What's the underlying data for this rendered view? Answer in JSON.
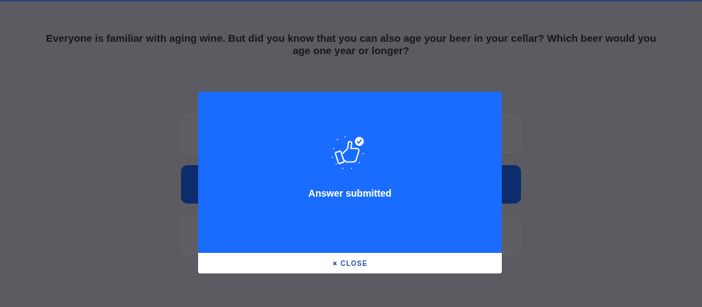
{
  "question": "Everyone is familiar with aging wine. But did you know that you can also age your beer in your cellar? Which beer would you age one year or longer?",
  "options": [
    {
      "selected": false
    },
    {
      "selected": true
    },
    {
      "selected": false
    }
  ],
  "dialog": {
    "message": "Answer submitted",
    "close_label": "CLOSE"
  }
}
